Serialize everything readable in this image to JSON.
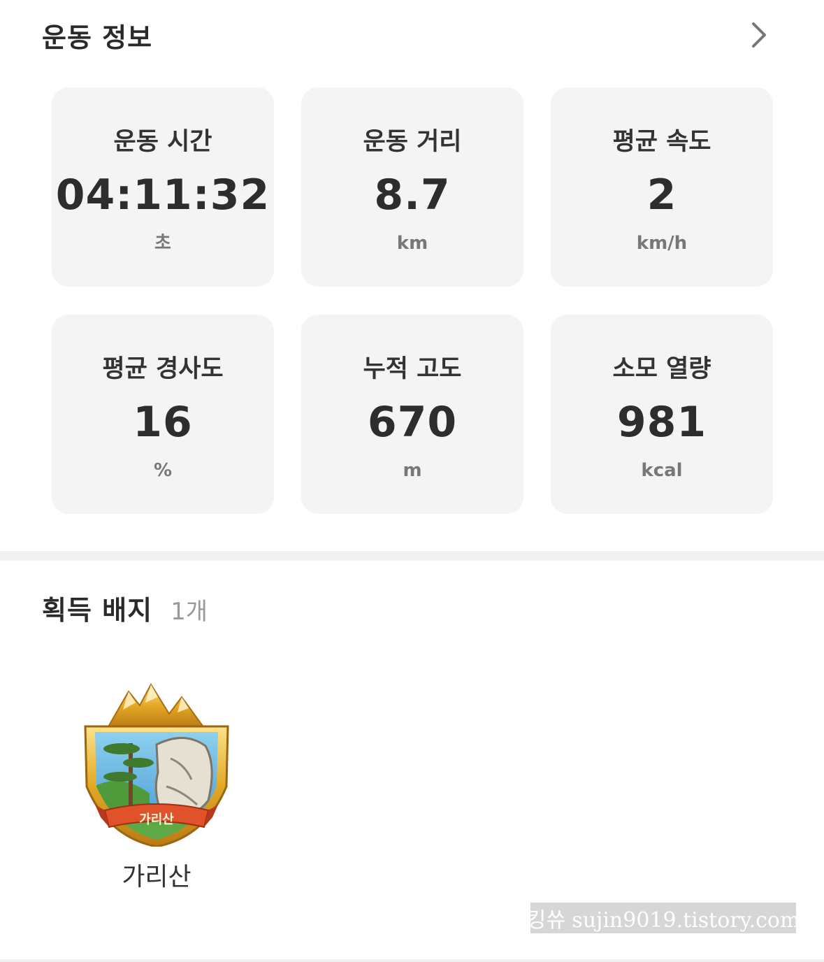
{
  "exercise_info": {
    "title": "운동 정보",
    "stats": [
      {
        "label": "운동 시간",
        "value": "04:11:32",
        "unit": "초"
      },
      {
        "label": "운동 거리",
        "value": "8.7",
        "unit": "km"
      },
      {
        "label": "평균 속도",
        "value": "2",
        "unit": "km/h"
      },
      {
        "label": "평균 경사도",
        "value": "16",
        "unit": "%"
      },
      {
        "label": "누적 고도",
        "value": "670",
        "unit": "m"
      },
      {
        "label": "소모 열량",
        "value": "981",
        "unit": "kcal"
      }
    ]
  },
  "badges": {
    "title": "획득 배지",
    "count": "1개",
    "items": [
      {
        "name": "가리산",
        "ribbon_text": "가리산"
      }
    ]
  },
  "watermark": "킹쓔 sujin9019.tistory.com",
  "colors": {
    "card_bg": "#f4f4f4",
    "badge_gold": "#e0a92a",
    "ribbon": "#e0532a"
  }
}
